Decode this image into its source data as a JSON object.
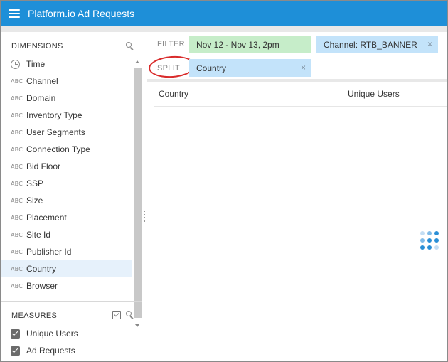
{
  "header": {
    "title": "Platform.io Ad Requests",
    "bg_color": "#1e8fd8"
  },
  "sidebar": {
    "dimensions_title": "DIMENSIONS",
    "type_label": "ABC",
    "dimensions": [
      {
        "label": "Time",
        "icon": "clock-icon"
      },
      {
        "label": "Channel",
        "icon": "string-type-icon"
      },
      {
        "label": "Domain",
        "icon": "string-type-icon"
      },
      {
        "label": "Inventory Type",
        "icon": "string-type-icon"
      },
      {
        "label": "User Segments",
        "icon": "string-type-icon"
      },
      {
        "label": "Connection Type",
        "icon": "string-type-icon"
      },
      {
        "label": "Bid Floor",
        "icon": "string-type-icon"
      },
      {
        "label": "SSP",
        "icon": "string-type-icon"
      },
      {
        "label": "Size",
        "icon": "string-type-icon"
      },
      {
        "label": "Placement",
        "icon": "string-type-icon"
      },
      {
        "label": "Site Id",
        "icon": "string-type-icon"
      },
      {
        "label": "Publisher Id",
        "icon": "string-type-icon"
      },
      {
        "label": "Country",
        "icon": "string-type-icon",
        "active": true
      },
      {
        "label": "Browser",
        "icon": "string-type-icon"
      }
    ],
    "measures_title": "MEASURES",
    "measures": [
      {
        "label": "Unique Users",
        "checked": true
      },
      {
        "label": "Ad Requests",
        "checked": true
      }
    ]
  },
  "filter_bar": {
    "label": "FILTER",
    "pills": [
      {
        "label": "Nov 12 - Nov 13, 2pm",
        "color": "#c6edc9"
      },
      {
        "label": "Channel:  RTB_BANNER",
        "color": "#c3e3fa",
        "close": "×"
      }
    ]
  },
  "split_bar": {
    "label": "SPLIT",
    "pills": [
      {
        "label": "Country",
        "color": "#c3e3fa",
        "close": "×"
      }
    ],
    "highlight_color": "#d92b2b"
  },
  "table": {
    "columns": [
      "Country",
      "Unique Users"
    ]
  },
  "loading_indicator": {
    "colors": [
      "#2a8fd6",
      "#7fbbe8",
      "#c3ddf3"
    ]
  }
}
